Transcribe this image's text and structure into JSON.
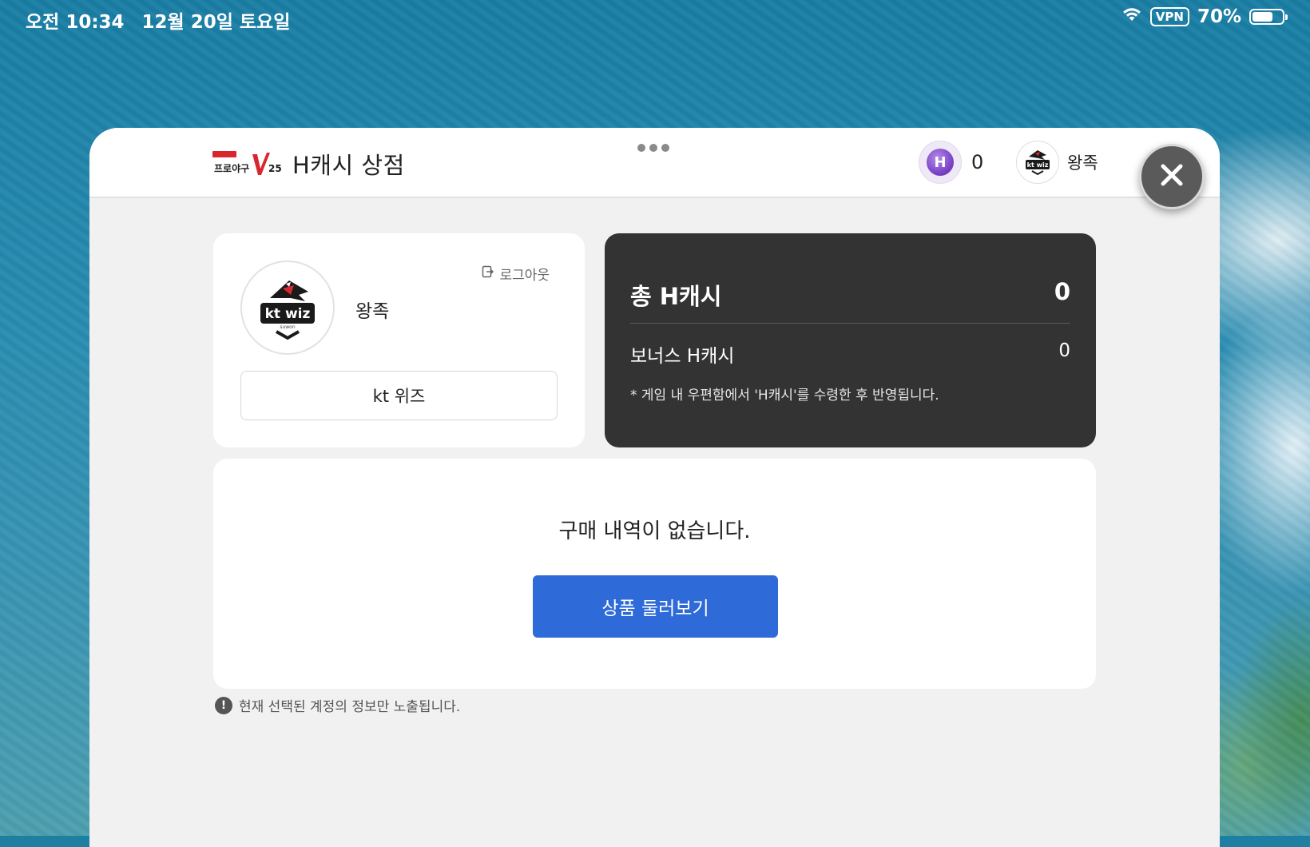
{
  "status_bar": {
    "time": "오전 10:34",
    "date": "12월 20일 토요일",
    "vpn": "VPN",
    "battery": "70%",
    "battery_level": 0.7
  },
  "header": {
    "brand_logo_text": "컴투스 프로야구 V25",
    "title": "H캐시 상점",
    "cash_value": "0",
    "user_name": "왕족"
  },
  "profile": {
    "team_logo_text": "kt wiz",
    "name": "왕족",
    "logout_label": "로그아웃",
    "team_label": "kt 위즈"
  },
  "cash": {
    "total_label": "총 H캐시",
    "total_value": "0",
    "bonus_label": "보너스 H캐시",
    "bonus_value": "0",
    "note": "* 게임 내 우편함에서 'H캐시'를 수령한 후 반영됩니다."
  },
  "history": {
    "empty_message": "구매 내역이 없습니다.",
    "browse_label": "상품 둘러보기"
  },
  "notice": {
    "text": "현재 선택된 계정의 정보만 노출됩니다."
  },
  "colors": {
    "accent": "#2f6bd8",
    "dark_card": "#333333",
    "modal_bg": "#f1f1f1",
    "coin": "#7c46c8"
  }
}
